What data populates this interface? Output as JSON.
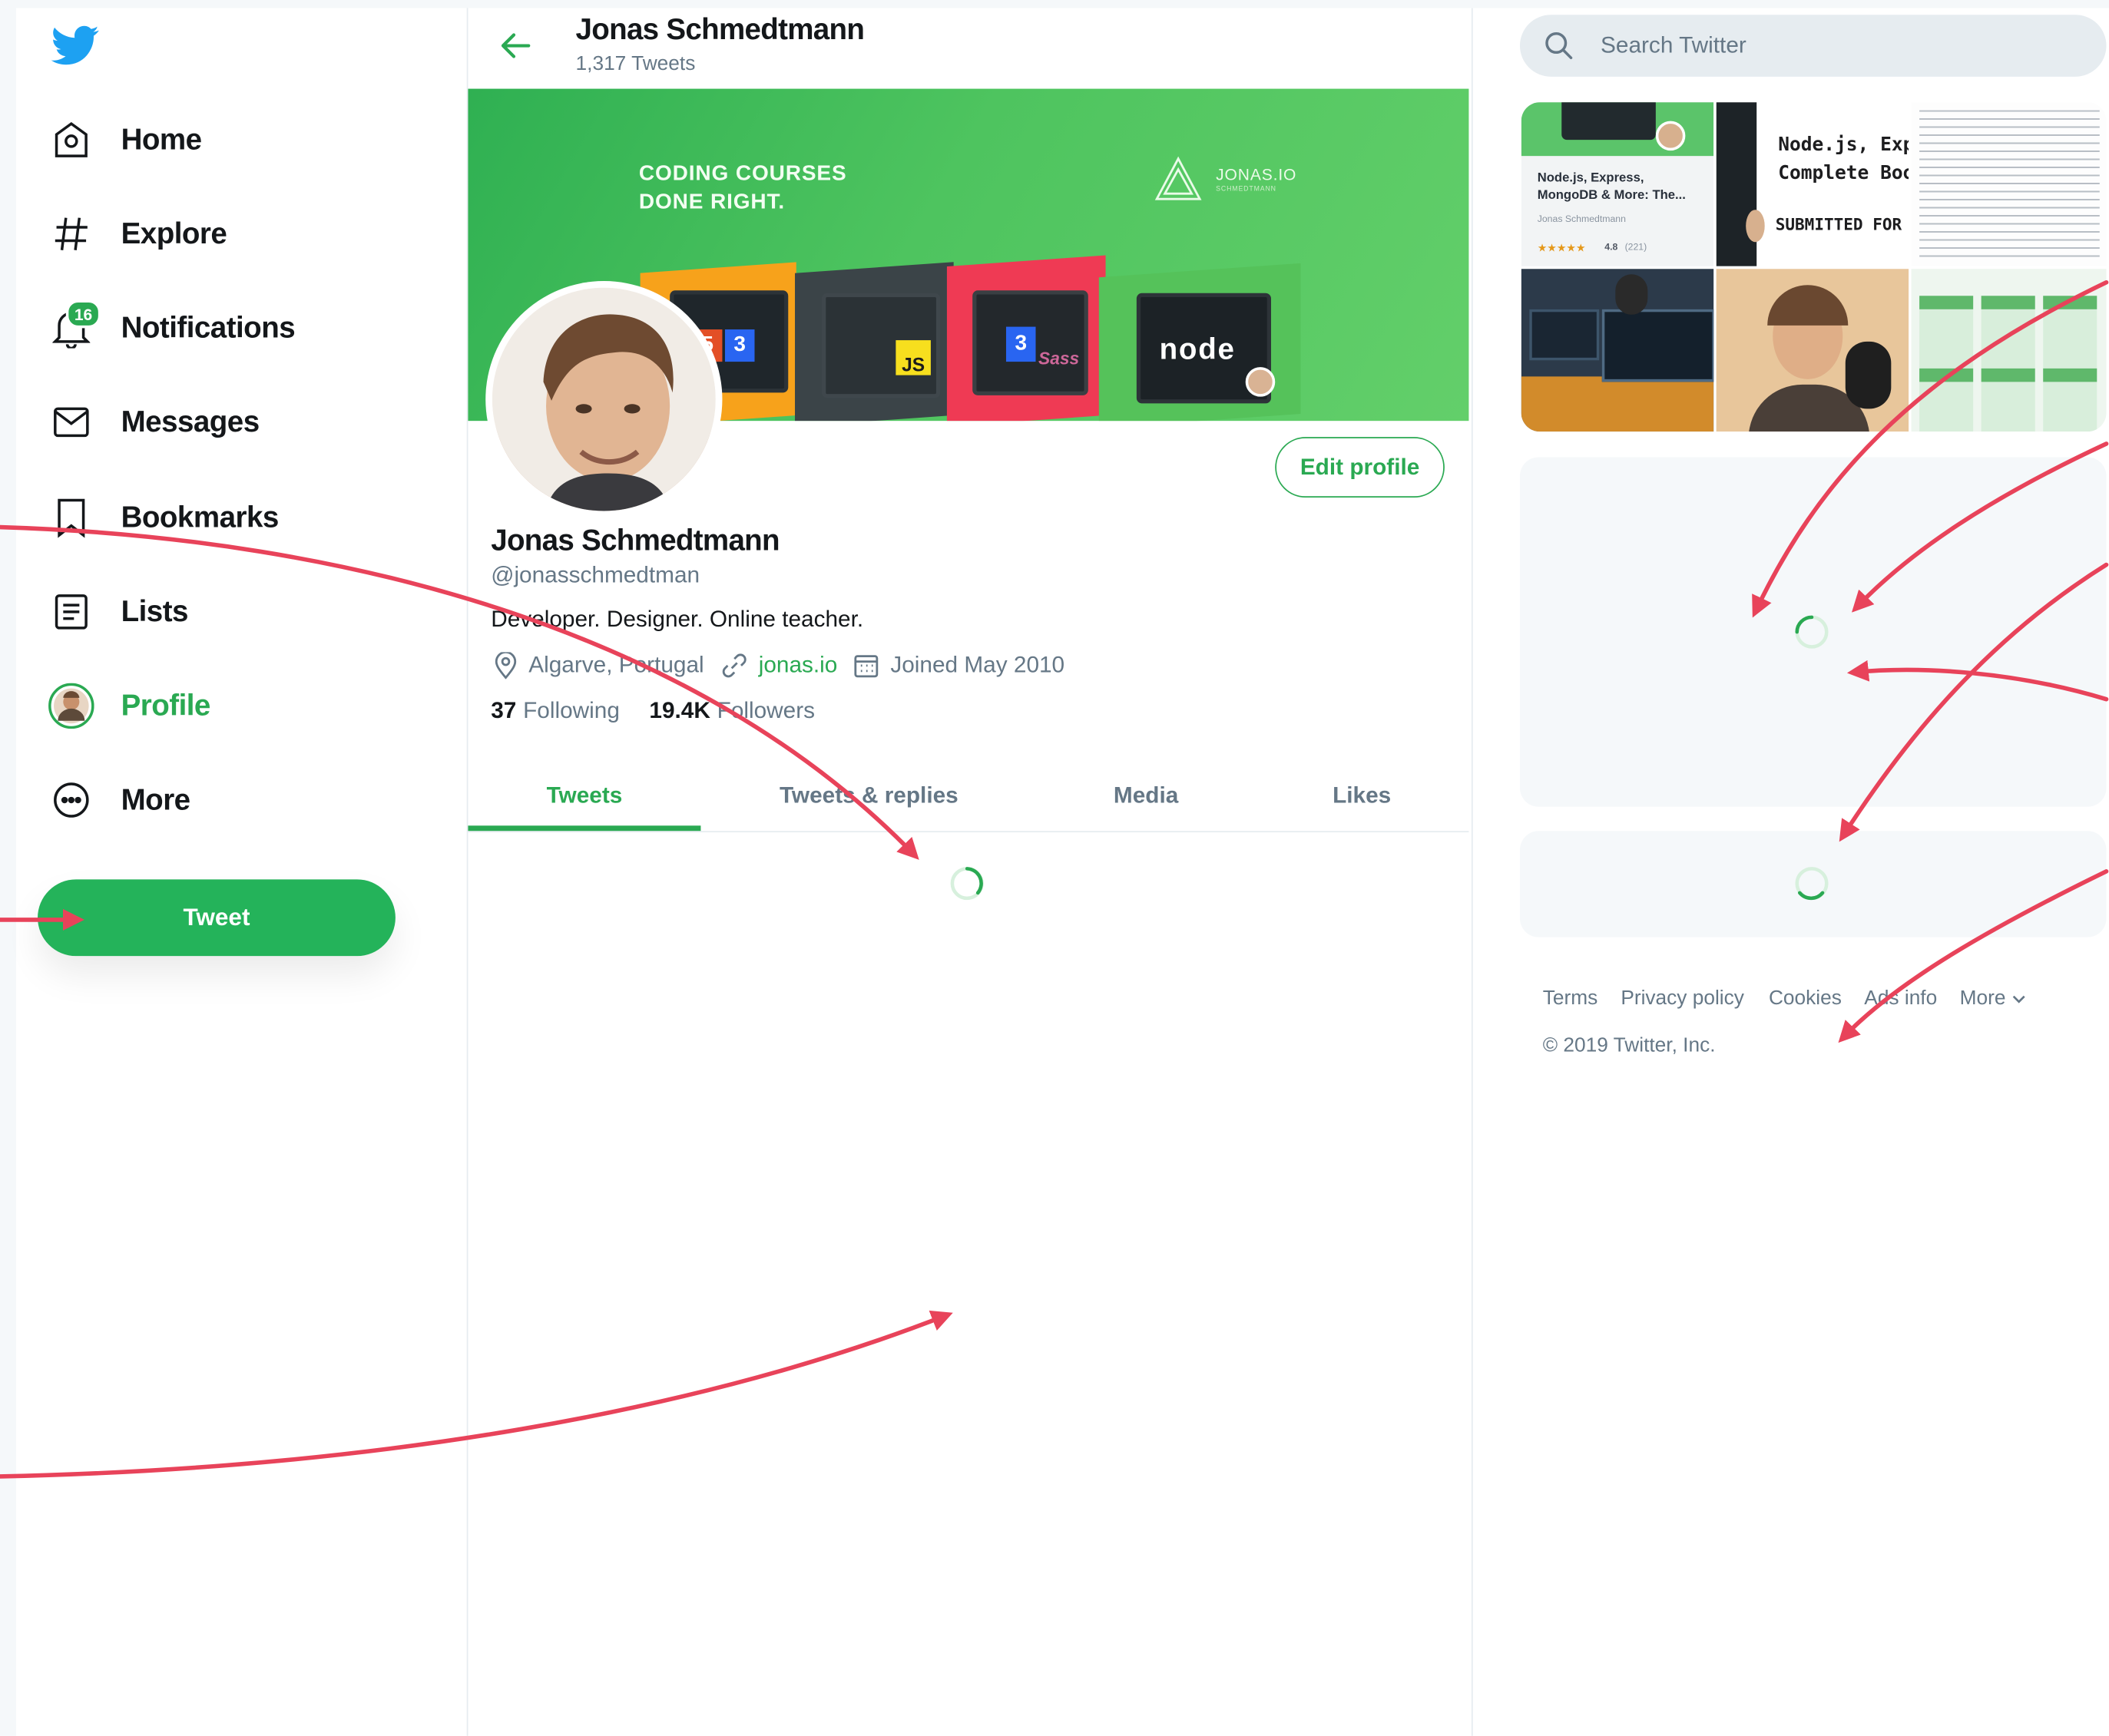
{
  "sidebar": {
    "nav": [
      {
        "label": "Home",
        "icon": "home-icon"
      },
      {
        "label": "Explore",
        "icon": "hashtag-icon"
      },
      {
        "label": "Notifications",
        "icon": "bell-icon",
        "badge": "16"
      },
      {
        "label": "Messages",
        "icon": "envelope-icon"
      },
      {
        "label": "Bookmarks",
        "icon": "bookmark-icon"
      },
      {
        "label": "Lists",
        "icon": "list-icon"
      },
      {
        "label": "Profile",
        "icon": "avatar-icon"
      },
      {
        "label": "More",
        "icon": "more-icon"
      }
    ],
    "tweet_button": "Tweet"
  },
  "header": {
    "name": "Jonas Schmedtmann",
    "tweet_count": "1,317 Tweets"
  },
  "banner": {
    "headline_line1": "CODING COURSES",
    "headline_line2": "DONE RIGHT.",
    "brand": "JONAS.IO",
    "brand_sub": "SCHMEDTMANN",
    "course_badges": [
      "5",
      "JS",
      "3",
      "node"
    ]
  },
  "profile": {
    "edit_button": "Edit profile",
    "name": "Jonas Schmedtmann",
    "handle": "@jonasschmedtman",
    "bio": "Developer. Designer. Online teacher.",
    "location": "Algarve, Portugal",
    "link": "jonas.io",
    "joined": "Joined May 2010",
    "following_count": "37",
    "following_label": "Following",
    "followers_count": "19.4K",
    "followers_label": "Followers"
  },
  "tabs": [
    "Tweets",
    "Tweets & replies",
    "Media",
    "Likes"
  ],
  "search": {
    "placeholder": "Search Twitter"
  },
  "media": {
    "thumb1_title": "Node.js, Express, MongoDB & More: The...",
    "thumb1_author": "Jonas Schmedtmann",
    "thumb1_rating": "4.8",
    "thumb1_reviews": "(221)",
    "thumb2_title_line1": "Node.js, Expre",
    "thumb2_title_line2": "Complete Boo",
    "thumb2_sub": "SUBMITTED FOR"
  },
  "footer": {
    "links": [
      "Terms",
      "Privacy policy",
      "Cookies",
      "Ads info",
      "More"
    ],
    "copyright": "© 2019 Twitter, Inc."
  },
  "colors": {
    "accent": "#2aa952",
    "twitter_blue": "#1da1f2",
    "annotation_arrow": "#e8435a"
  }
}
